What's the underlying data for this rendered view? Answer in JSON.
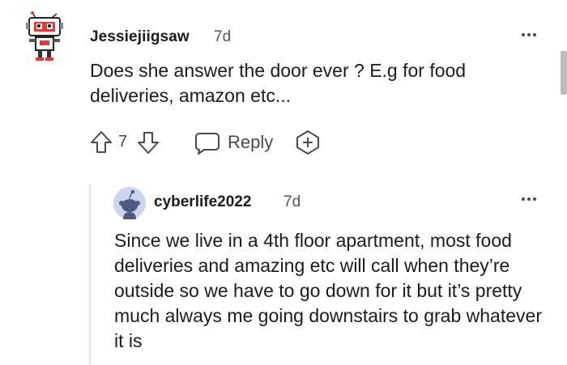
{
  "comment": {
    "username": "Jessiejiigsaw",
    "time": "7d",
    "body": "Does she answer the door ever ? E.g for food deliveries, amazon etc...",
    "score": "7",
    "reply_label": "Reply",
    "avatar_icon": "robot-avatar-icon"
  },
  "reply": {
    "username": "cyberlife2022",
    "time": "7d",
    "body": "Since we live in a 4th floor apartment, most food deliveries and amazing etc will call when they’re outside so we have to go down for it but it’s pretty much always me going downstairs to grab whatever it is",
    "avatar_icon": "default-snoo-avatar-icon"
  },
  "colors": {
    "text": "#1c1c1c",
    "muted": "#555555",
    "icon": "#4a4a4a",
    "thread_line": "#e2e2e2",
    "avatar_bg": "#cdd4f2"
  }
}
